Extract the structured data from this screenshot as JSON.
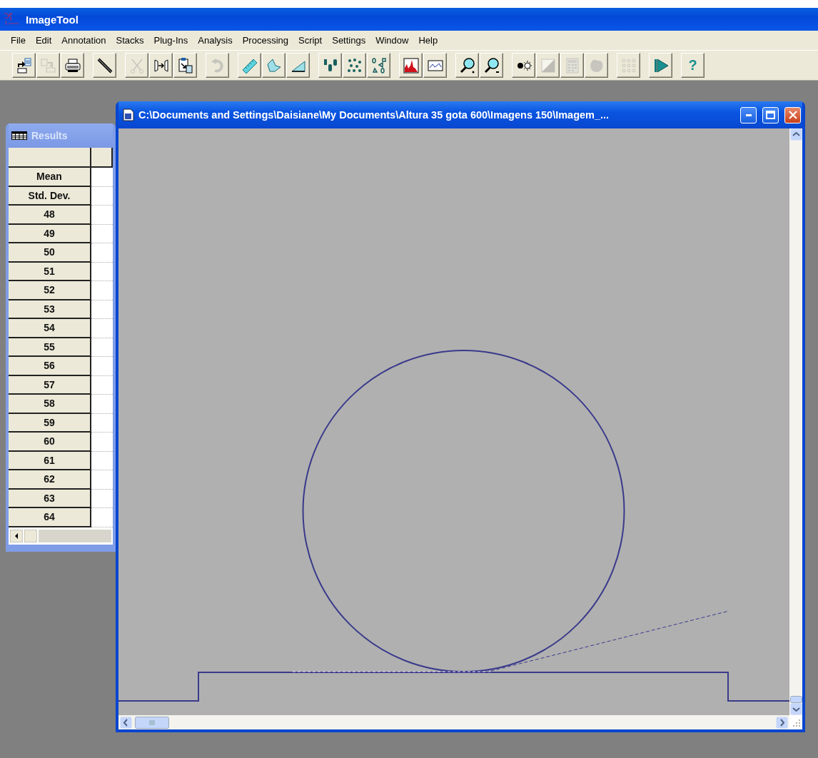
{
  "app": {
    "title": "ImageTool"
  },
  "menu": [
    "File",
    "Edit",
    "Annotation",
    "Stacks",
    "Plug-Ins",
    "Analysis",
    "Processing",
    "Script",
    "Settings",
    "Window",
    "Help"
  ],
  "toolbar": [
    [
      {
        "disabled": false
      },
      {
        "disabled": true
      },
      {
        "disabled": false
      }
    ],
    [
      {
        "disabled": false
      }
    ],
    [
      {
        "disabled": true
      },
      {
        "disabled": false
      },
      {
        "disabled": false
      }
    ],
    [
      {
        "disabled": true
      }
    ],
    [
      {
        "disabled": false
      },
      {
        "disabled": false
      },
      {
        "disabled": false
      }
    ],
    [
      {
        "disabled": false
      },
      {
        "disabled": false
      },
      {
        "disabled": false
      }
    ],
    [
      {
        "disabled": false
      },
      {
        "disabled": false
      }
    ],
    [
      {
        "disabled": false
      },
      {
        "disabled": false
      }
    ],
    [
      {
        "disabled": false
      },
      {
        "disabled": true
      },
      {
        "disabled": true
      },
      {
        "disabled": true
      }
    ],
    [
      {
        "disabled": true
      }
    ],
    [
      {
        "disabled": false
      }
    ],
    [
      {
        "disabled": false,
        "text": "?"
      }
    ]
  ],
  "results_window": {
    "title": "Results",
    "rows": [
      "Mean",
      "Std. Dev.",
      "48",
      "49",
      "50",
      "51",
      "52",
      "53",
      "54",
      "55",
      "56",
      "57",
      "58",
      "59",
      "60",
      "61",
      "62",
      "63",
      "64"
    ]
  },
  "image_window": {
    "title": "C:\\Documents and Settings\\Daisiane\\My Documents\\Altura 35 gota 600\\Imagens 150\\Imagem_..."
  }
}
